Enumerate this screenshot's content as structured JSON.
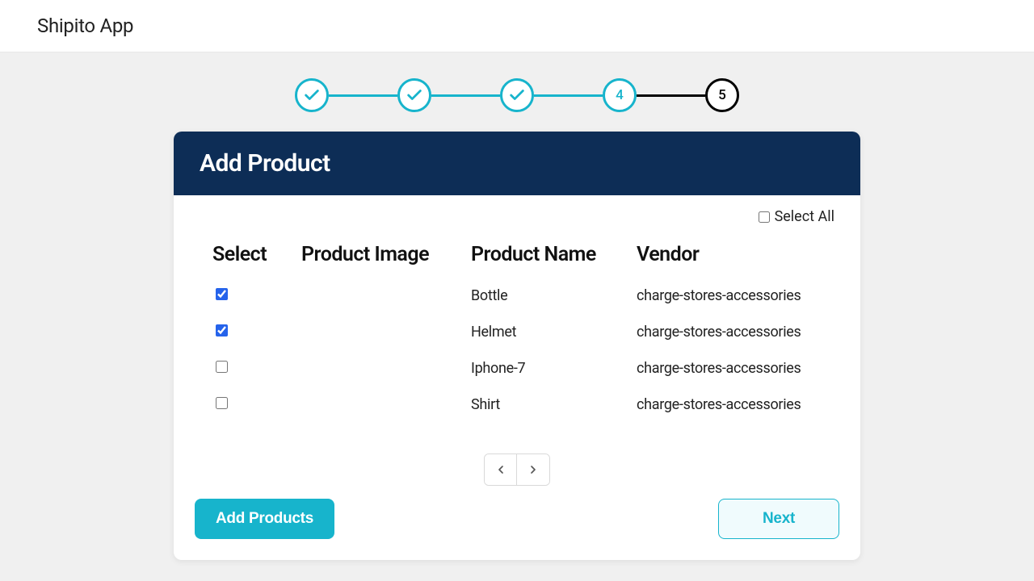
{
  "app": {
    "title": "Shipito App"
  },
  "stepper": {
    "steps": [
      {
        "state": "done"
      },
      {
        "state": "done"
      },
      {
        "state": "done"
      },
      {
        "state": "active",
        "label": "4"
      },
      {
        "state": "pending",
        "label": "5"
      }
    ]
  },
  "card": {
    "title": "Add Product",
    "selectAllLabel": "Select All",
    "selectAllChecked": false,
    "columns": {
      "select": "Select",
      "image": "Product Image",
      "name": "Product Name",
      "vendor": "Vendor"
    },
    "rows": [
      {
        "checked": true,
        "name": "Bottle",
        "vendor": "charge-stores-accessories"
      },
      {
        "checked": true,
        "name": "Helmet",
        "vendor": "charge-stores-accessories"
      },
      {
        "checked": false,
        "name": "Iphone-7",
        "vendor": "charge-stores-accessories"
      },
      {
        "checked": false,
        "name": "Shirt",
        "vendor": "charge-stores-accessories"
      }
    ],
    "buttons": {
      "add": "Add Products",
      "next": "Next"
    }
  }
}
